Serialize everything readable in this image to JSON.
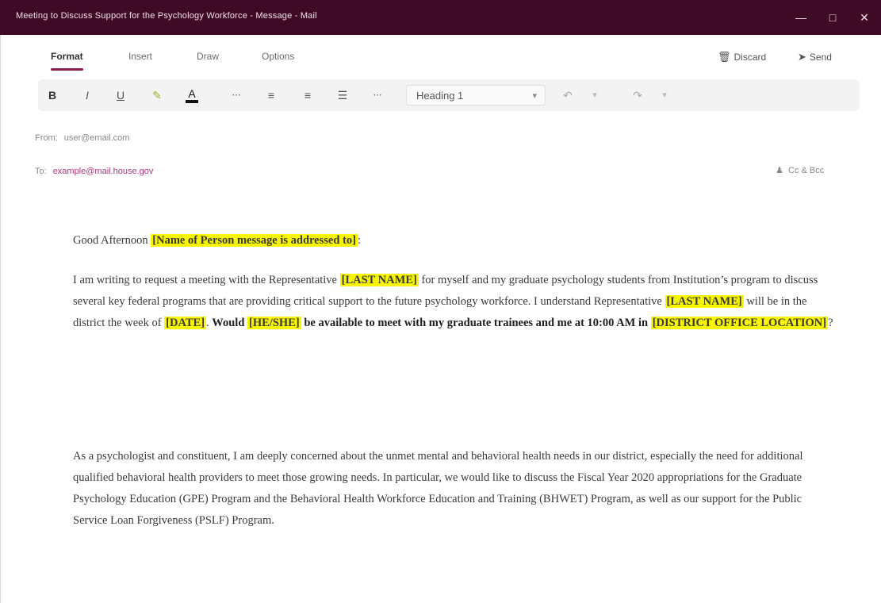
{
  "window": {
    "title": "Meeting to Discuss Support for the Psychology Workforce - Message - Mail",
    "controls": [
      "minimize",
      "maximize",
      "close"
    ]
  },
  "tabs": [
    {
      "label": "Format",
      "active": true
    },
    {
      "label": "Insert",
      "active": false
    },
    {
      "label": "Draw",
      "active": false
    },
    {
      "label": "Options",
      "active": false
    }
  ],
  "actions": {
    "discard_label": "Discard",
    "send_label": "Send"
  },
  "ribbon": {
    "buttons": [
      "bold",
      "italic",
      "underline",
      "highlight",
      "font-color",
      "more",
      "bullets",
      "numbering",
      "align",
      "more2"
    ],
    "bold_glyph": "B",
    "italic_glyph": "I",
    "underline_glyph": "U",
    "style_value": "Heading 1",
    "undo_glyph": "↶",
    "redo_glyph": "↷"
  },
  "from": {
    "label": "From:",
    "value": "user@email.com"
  },
  "to": {
    "label": "To:",
    "value": "example@mail.house.gov"
  },
  "cc_bcc": "Cc & Bcc",
  "message": {
    "greeting": "Good Afternoon ",
    "greeting_hl": "[Name of Person message is addressed to]",
    "greeting_end": ":",
    "p2_a": "I am writing to request a meeting with the Representative ",
    "p2_hl1": "[LAST NAME]",
    "p2_b": " for myself and my graduate psychology students from Institution’s program to discuss several key federal programs that are providing critical support to the future psychology workforce. I understand Representative ",
    "p2_hl2": "[LAST NAME]",
    "p2_c": " will be in the district the week of ",
    "p2_hl3": "[DATE]",
    "p2_d": ". ",
    "p2_bold1": "Would ",
    "p2_hl4": "[HE/SHE]",
    "p2_bold2": " be available to meet with my graduate trainees and me at 10:00 AM in ",
    "p2_hl5": "[DISTRICT OFFICE LOCATION]",
    "p2_e": "?",
    "p3": "As a psychologist and constituent, I am deeply concerned about the unmet mental and behavioral health needs in our district, especially the need for additional qualified behavioral health providers to meet those growing needs. In particular, we would like to discuss the Fiscal Year 2020 appropriations for the Graduate Psychology Education (GPE) Program and the Behavioral Health Workforce Education and Training (BHWET) Program, as well as our support for the Public Service Loan Forgiveness (PSLF) Program."
  },
  "colors": {
    "titlebar": "#3f0a26",
    "accent": "#8b1d4e",
    "highlight": "#f7f500",
    "link": "#b4327a"
  }
}
